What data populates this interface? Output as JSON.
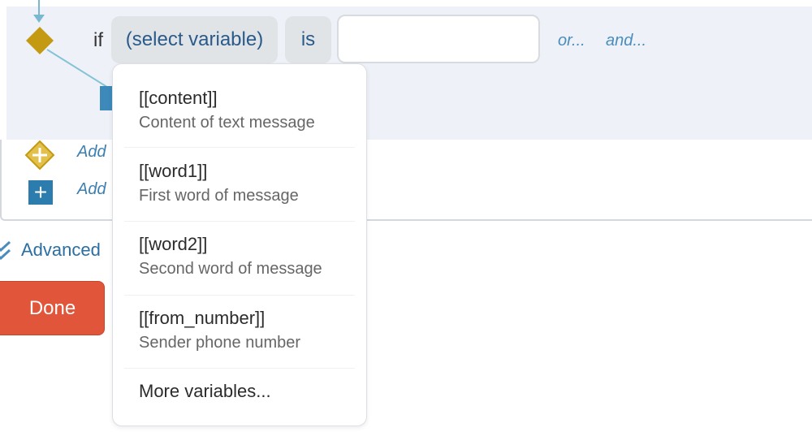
{
  "condition": {
    "if_label": "if",
    "variable_placeholder": "(select variable)",
    "operator": "is",
    "value": "",
    "or_link": "or...",
    "and_link": "and..."
  },
  "add_rows": {
    "add_condition_label": "Add",
    "add_action_label": "Add"
  },
  "advanced": {
    "label": "Advanced"
  },
  "done_button": {
    "label": "Done"
  },
  "variable_dropdown": {
    "items": [
      {
        "code": "[[content]]",
        "description": "Content of text message"
      },
      {
        "code": "[[word1]]",
        "description": "First word of message"
      },
      {
        "code": "[[word2]]",
        "description": "Second word of message"
      },
      {
        "code": "[[from_number]]",
        "description": "Sender phone number"
      }
    ],
    "more_label": "More variables..."
  },
  "colors": {
    "condition_diamond": "#c49a12",
    "action_blue": "#2c7cae",
    "done_orange": "#e1563a",
    "link_blue": "#4a8dbd",
    "panel_bg": "#eef2f8"
  },
  "icons": {
    "condition": "diamond-icon",
    "add_condition": "diamond-plus-icon",
    "add_action": "square-plus-icon",
    "advanced": "double-check-icon"
  }
}
